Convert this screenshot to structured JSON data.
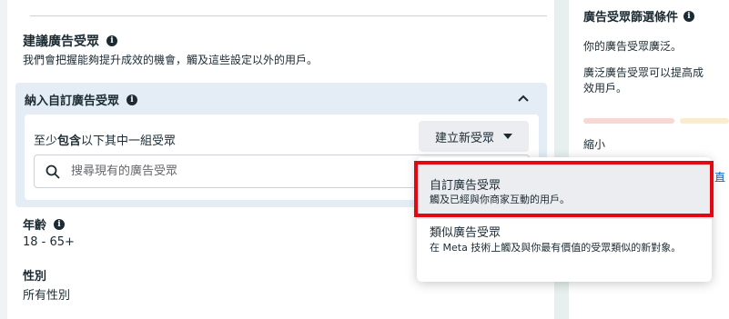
{
  "suggestion": {
    "title": "建議廣告受眾",
    "description": "我們會把握能夠提升成效的機會，觸及這些設定以外的用戶。"
  },
  "custom_audience": {
    "title": "納入自訂廣告受眾",
    "include_prefix": "至少",
    "include_bold": "包含",
    "include_suffix": "以下其中一組受眾",
    "create_button_label": "建立新受眾",
    "search_placeholder": "搜尋現有的廣告受眾"
  },
  "age": {
    "label": "年齡",
    "value": "18 - 65+"
  },
  "gender": {
    "label": "性別",
    "value": "所有性別"
  },
  "right_panel": {
    "title": "廣告受眾篩選條件",
    "text1": "你的廣告受眾廣泛。",
    "text2": "廣泛廣告受眾可以提高成效用戶。",
    "text3": "縮小",
    "link_fragment": "直"
  },
  "dropdown": {
    "items": [
      {
        "title": "自訂廣告受眾",
        "description": "觸及已經與你商家互動的用戶。",
        "highlighted": true
      },
      {
        "title": "類似廣告受眾",
        "description": "在 Meta 技術上觸及與你最有價值的受眾類似的新對象。",
        "highlighted": false
      }
    ]
  },
  "colors": {
    "highlight_border": "#e30613",
    "panel_bg": "#e4edf6",
    "link": "#0064d1"
  },
  "icons": [
    "info-icon",
    "chevron-up-icon",
    "caret-down-icon",
    "search-icon"
  ]
}
